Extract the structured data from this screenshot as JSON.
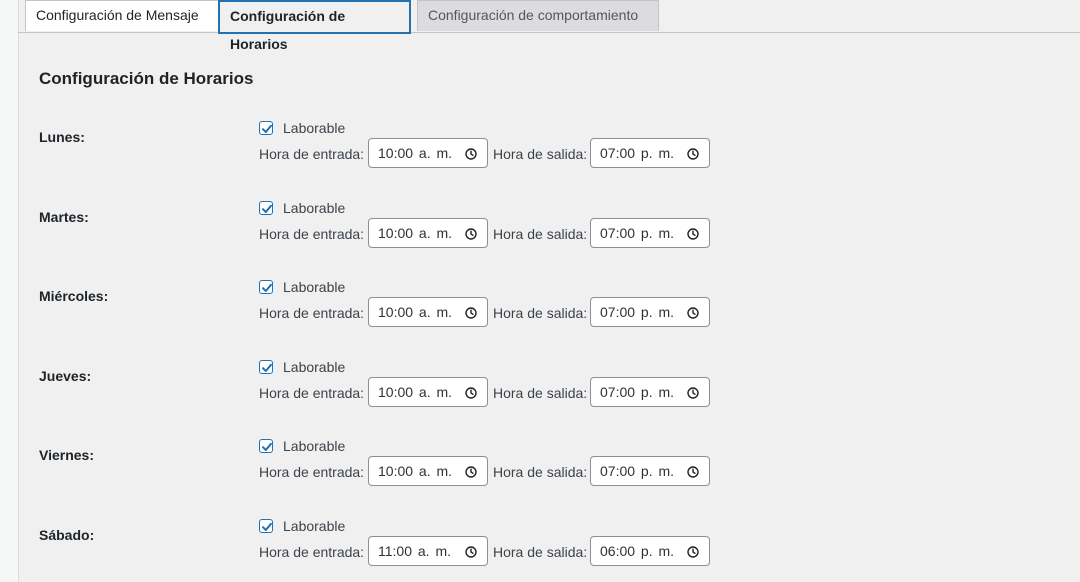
{
  "tabs": [
    {
      "label": "Configuración de Mensaje"
    },
    {
      "label": "Configuración de Horarios"
    },
    {
      "label": "Configuración de comportamiento"
    }
  ],
  "section_title": "Configuración de Horarios",
  "checkbox_label": "Laborable",
  "entry_label": "Hora de entrada:",
  "exit_label": "Hora de salida:",
  "days": [
    {
      "name": "Lunes:",
      "workday": true,
      "entry": "10:00 a. m.",
      "exit": "07:00 p. m."
    },
    {
      "name": "Martes:",
      "workday": true,
      "entry": "10:00 a. m.",
      "exit": "07:00 p. m."
    },
    {
      "name": "Miércoles:",
      "workday": true,
      "entry": "10:00 a. m.",
      "exit": "07:00 p. m."
    },
    {
      "name": "Jueves:",
      "workday": true,
      "entry": "10:00 a. m.",
      "exit": "07:00 p. m."
    },
    {
      "name": "Viernes:",
      "workday": true,
      "entry": "10:00 a. m.",
      "exit": "07:00 p. m."
    },
    {
      "name": "Sábado:",
      "workday": true,
      "entry": "11:00 a. m.",
      "exit": "06:00 p. m."
    }
  ],
  "colors": {
    "accent": "#2271b1",
    "background": "#f0f0f1"
  }
}
